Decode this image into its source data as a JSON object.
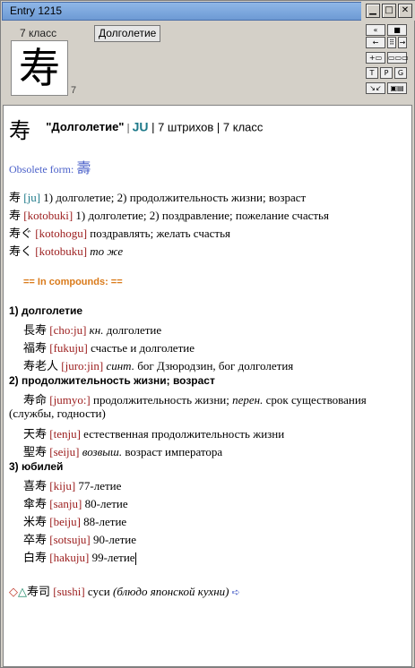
{
  "window": {
    "title": "Entry 1215"
  },
  "titlebar_buttons": {
    "minimize": "▁",
    "maximize": "□",
    "close": "✕"
  },
  "header": {
    "grade": "7 класс",
    "meaning": "Долголетие",
    "kanji": "寿",
    "strokes": "7"
  },
  "nav_buttons": [
    {
      "icon": "first-icon",
      "glyph": "«"
    },
    {
      "icon": "stop-icon",
      "glyph": "■"
    },
    {
      "icon": "prev-icon",
      "glyph": "←"
    },
    {
      "icon": "list-icon",
      "glyph": "⠿"
    },
    {
      "icon": "next-icon",
      "glyph": "→"
    },
    {
      "icon": "last-icon",
      "glyph": "»"
    },
    {
      "icon": "add-icon",
      "glyph": "+▭"
    },
    {
      "icon": "panels-icon",
      "glyph": "▭▭▭"
    },
    {
      "icon": "text-icon",
      "glyph": "T"
    },
    {
      "icon": "print-icon",
      "glyph": "P"
    },
    {
      "icon": "grid-icon",
      "glyph": "G"
    },
    {
      "icon": "shrink-icon",
      "glyph": "↘↙"
    },
    {
      "icon": "options-icon",
      "glyph": "▣▤"
    }
  ],
  "entry": {
    "kanji": "寿",
    "meaning": "\"Долголетие\"",
    "sep1": " | ",
    "reading": "JU",
    "strokes_text": " | 7 штрихов | 7 класс",
    "obsolete_label": "Obsolete form: ",
    "obsolete_kanji": "壽",
    "readings": [
      {
        "word": "寿",
        "reading": "[ju]",
        "text": " 1) долголетие; 2) продолжительность жизни; возраст",
        "italic": ""
      },
      {
        "word": "寿",
        "reading": "[kotobuki]",
        "text": " 1) долголетие; 2) поздравление; пожелание счастья",
        "italic": ""
      },
      {
        "word": "寿ぐ",
        "reading": "[kotohogu]",
        "text": " поздравлять; желать счастья",
        "italic": ""
      },
      {
        "word": "寿く",
        "reading": "[kotobuku]",
        "text": " ",
        "italic": "то же"
      }
    ],
    "compounds_header": "== In compounds: ==",
    "group1": "1) долголетие",
    "c1": [
      {
        "word": "長寿",
        "reading": "[cho:ju]",
        "italic": "кн.",
        "text": " долголетие"
      },
      {
        "word": "福寿",
        "reading": "[fukuju]",
        "italic": "",
        "text": " счастье и долголетие"
      },
      {
        "word": "寿老人",
        "reading": "[juro:jin]",
        "italic": "синт.",
        "text": " бог Дзюродзин, бог долголетия"
      }
    ],
    "group2": "2) продолжительность жизни;  возраст",
    "c2a": {
      "word": "寿命",
      "reading": "[jumyo:]",
      "text1": " продолжительность жизни; ",
      "italic": "перен.",
      "text2": " срок существования"
    },
    "c2a_cont": "(службы, годности)",
    "c2": [
      {
        "word": "天寿",
        "reading": "[tenju]",
        "italic": "",
        "text": " естественная продолжительность жизни"
      },
      {
        "word": "聖寿",
        "reading": "[seiju]",
        "italic": "возвыш.",
        "text": " возраст императора"
      }
    ],
    "group3": "3) юбилей",
    "c3": [
      {
        "word": "喜寿",
        "reading": "[kiju]",
        "text": " 77-летие"
      },
      {
        "word": "傘寿",
        "reading": "[sanju]",
        "text": " 80-летие"
      },
      {
        "word": "米寿",
        "reading": "[beiju]",
        "text": " 88-летие"
      },
      {
        "word": "卒寿",
        "reading": "[sotsuju]",
        "text": " 90-летие"
      },
      {
        "word": "白寿",
        "reading": "[hakuju]",
        "text": " 99-летие"
      }
    ],
    "sushi": {
      "mark1": "◇",
      "mark2": "△",
      "word": "寿司",
      "reading": "[sushi]",
      "text": " суси ",
      "italic": "(блюдо японской кухни)",
      "arrow": "➪"
    }
  }
}
